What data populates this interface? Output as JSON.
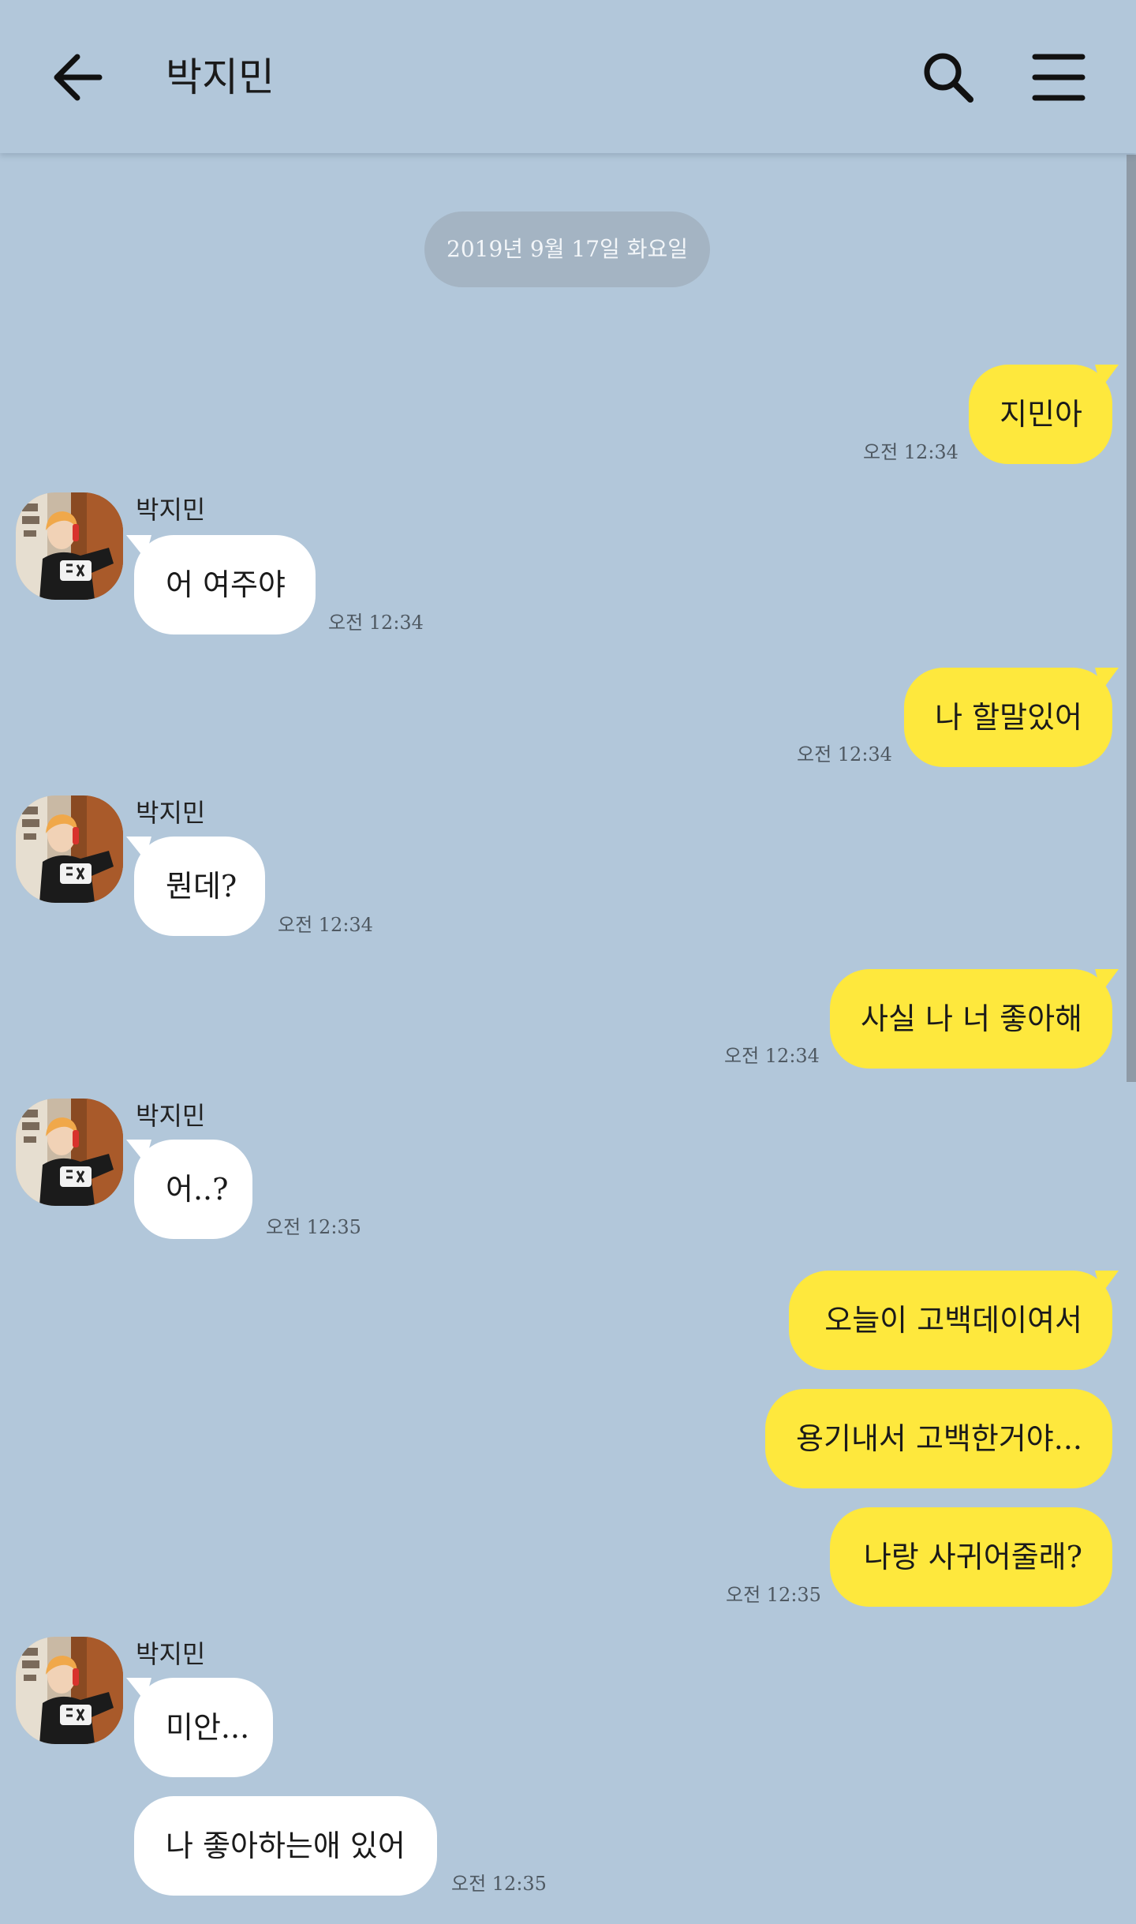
{
  "header": {
    "title": "박지민",
    "back_icon": "arrow-left-icon",
    "search_icon": "search-icon",
    "menu_icon": "hamburger-menu-icon"
  },
  "date_divider": "2019년 9월 17일 화요일",
  "colors": {
    "background": "#b2c7da",
    "outgoing_bubble": "#fee83d",
    "incoming_bubble": "#ffffff"
  },
  "messages": [
    {
      "sender": "",
      "text": "지민아",
      "time": "오전 12:34"
    },
    {
      "sender": "박지민",
      "text": "어 여주야",
      "time": "오전 12:34"
    },
    {
      "sender": "",
      "text": "나 할말있어",
      "time": "오전 12:34"
    },
    {
      "sender": "박지민",
      "text": "뭔데?",
      "time": "오전 12:34"
    },
    {
      "sender": "",
      "text": "사실 나 너 좋아해",
      "time": "오전 12:34"
    },
    {
      "sender": "박지민",
      "text": "어..?",
      "time": "오전 12:35"
    },
    {
      "sender": "",
      "text": "오늘이 고백데이여서",
      "time": ""
    },
    {
      "sender": "",
      "text": "용기내서 고백한거야...",
      "time": ""
    },
    {
      "sender": "",
      "text": "나랑 사귀어줄래?",
      "time": "오전 12:35"
    },
    {
      "sender": "박지민",
      "text": "미안...",
      "time": ""
    },
    {
      "sender": "",
      "text": "나 좋아하는애 있어",
      "time": "오전 12:35"
    }
  ]
}
